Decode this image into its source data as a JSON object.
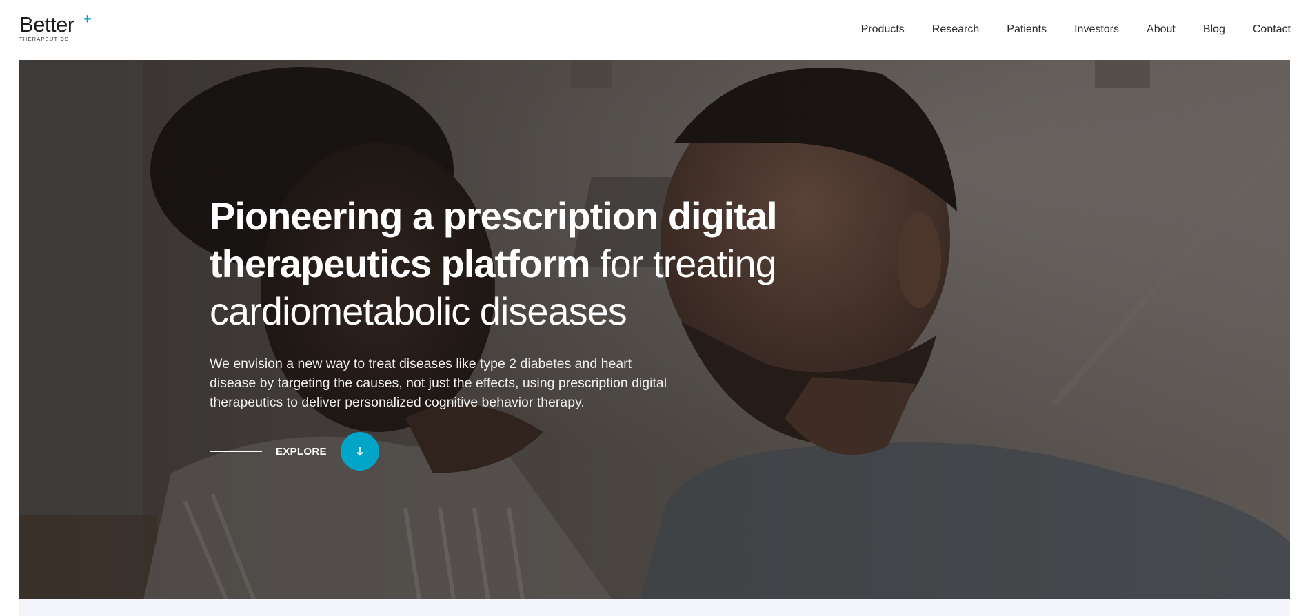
{
  "logo": {
    "word": "Better",
    "plus": "+",
    "sub": "THERAPEUTICS"
  },
  "nav": {
    "items": [
      {
        "label": "Products"
      },
      {
        "label": "Research"
      },
      {
        "label": "Patients"
      },
      {
        "label": "Investors"
      },
      {
        "label": "About"
      },
      {
        "label": "Blog"
      },
      {
        "label": "Contact"
      }
    ]
  },
  "hero": {
    "headline_bold": "Pioneering a prescription digital therapeutics platform",
    "headline_light": " for treating cardiometabolic diseases",
    "subtext": "We envision a new way to treat diseases like type 2 diabetes and heart disease by targeting the causes, not just the effects, using prescription digital therapeutics to deliver personalized cognitive behavior therapy.",
    "explore_label": "EXPLORE",
    "explore_icon": "arrow-down-icon"
  },
  "colors": {
    "accent": "#00a5c8",
    "nav_text": "#2b2b2b",
    "hero_text": "#ffffff"
  }
}
